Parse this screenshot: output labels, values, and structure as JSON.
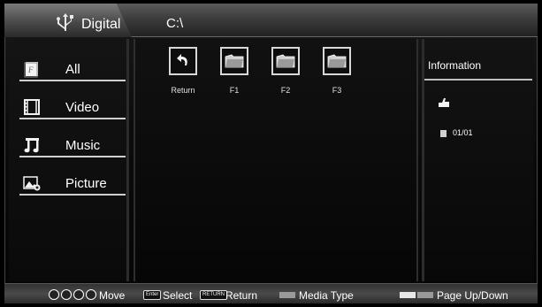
{
  "header": {
    "source_label": "Digital",
    "path": "C:\\",
    "source_icon": "usb-icon"
  },
  "sidebar": {
    "items": [
      {
        "label": "All",
        "icon": "all-files-icon"
      },
      {
        "label": "Video",
        "icon": "film-icon"
      },
      {
        "label": "Music",
        "icon": "music-note-icon"
      },
      {
        "label": "Picture",
        "icon": "picture-icon"
      }
    ]
  },
  "files": [
    {
      "label": "Return",
      "icon": "return-arrow-icon"
    },
    {
      "label": "F1",
      "icon": "folder-icon"
    },
    {
      "label": "F2",
      "icon": "folder-icon"
    },
    {
      "label": "F3",
      "icon": "folder-icon"
    }
  ],
  "info": {
    "title": "Information",
    "page": "01/01"
  },
  "footer": {
    "move_label": "Move",
    "enter_key": "Enter",
    "select_label": "Select",
    "return_key": "RETURN",
    "return_label": "Return",
    "media_type_label": "Media Type",
    "page_label": "Page Up/Down"
  },
  "colors": {
    "text": "#ffffff",
    "rule": "#cfcfcf",
    "key_gray": "#9a9a9a"
  }
}
